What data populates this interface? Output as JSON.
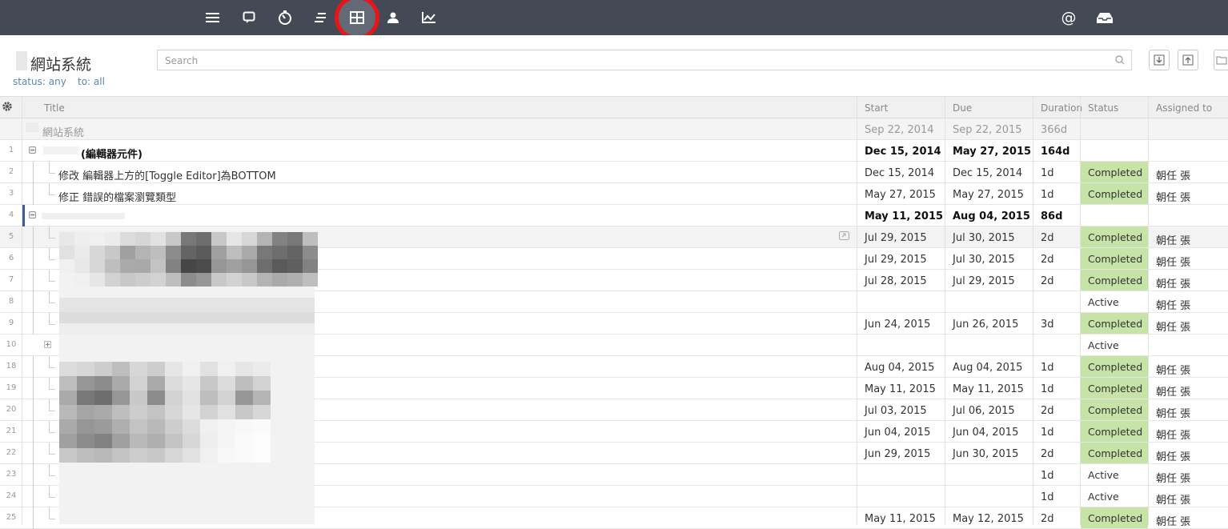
{
  "topbar": {
    "icons": [
      "menu-icon",
      "comment-icon",
      "timer-icon",
      "align-icon",
      "table-icon",
      "user-icon",
      "chart-icon"
    ],
    "right_icons": [
      "at-icon",
      "inbox-icon"
    ]
  },
  "header": {
    "project_title": "網站系統",
    "filter_status": "status: any",
    "filter_to": "to: all",
    "search_placeholder": "Search"
  },
  "columns": {
    "title": "Title",
    "start": "Start",
    "due": "Due",
    "duration": "Duration",
    "status": "Status",
    "assigned": "Assigned to"
  },
  "summary": {
    "title": "網站系統",
    "start": "Sep 22, 2014",
    "due": "Sep 22, 2015",
    "duration": "366d"
  },
  "rows": [
    {
      "num": "1",
      "title": "(編輯器元件)",
      "start": "Dec 15, 2014",
      "due": "May 27, 2015",
      "duration": "164d",
      "status": "",
      "assigned": ""
    },
    {
      "num": "2",
      "title": "修改 編輯器上方的[Toggle Editor]為BOTTOM",
      "start": "Dec 15, 2014",
      "due": "Dec 15, 2014",
      "duration": "1d",
      "status": "Completed",
      "assigned": "朝任 張"
    },
    {
      "num": "3",
      "title": "修正 錯誤的檔案瀏覽類型",
      "start": "May 27, 2015",
      "due": "May 27, 2015",
      "duration": "1d",
      "status": "Completed",
      "assigned": "朝任 張"
    },
    {
      "num": "4",
      "title": "",
      "start": "May 11, 2015",
      "due": "Aug 04, 2015",
      "duration": "86d",
      "status": "",
      "assigned": ""
    },
    {
      "num": "5",
      "title": "",
      "start": "Jul 29, 2015",
      "due": "Jul 30, 2015",
      "duration": "2d",
      "status": "Completed",
      "assigned": "朝任 張"
    },
    {
      "num": "6",
      "title": "",
      "start": "Jul 29, 2015",
      "due": "Jul 30, 2015",
      "duration": "2d",
      "status": "Completed",
      "assigned": "朝任 張"
    },
    {
      "num": "7",
      "title": "",
      "start": "Jul 28, 2015",
      "due": "Jul 29, 2015",
      "duration": "2d",
      "status": "Completed",
      "assigned": "朝任 張"
    },
    {
      "num": "8",
      "title": "",
      "start": "",
      "due": "",
      "duration": "",
      "status": "Active",
      "assigned": "朝任 張"
    },
    {
      "num": "9",
      "title": "",
      "start": "Jun 24, 2015",
      "due": "Jun 26, 2015",
      "duration": "3d",
      "status": "Completed",
      "assigned": "朝任 張"
    },
    {
      "num": "10",
      "title": "",
      "start": "",
      "due": "",
      "duration": "",
      "status": "Active",
      "assigned": ""
    },
    {
      "num": "18",
      "title": "",
      "start": "Aug 04, 2015",
      "due": "Aug 04, 2015",
      "duration": "1d",
      "status": "Completed",
      "assigned": "朝任 張"
    },
    {
      "num": "19",
      "title": "",
      "start": "May 11, 2015",
      "due": "May 11, 2015",
      "duration": "1d",
      "status": "Completed",
      "assigned": "朝任 張"
    },
    {
      "num": "20",
      "title": "",
      "start": "Jul 03, 2015",
      "due": "Jul 06, 2015",
      "duration": "2d",
      "status": "Completed",
      "assigned": "朝任 張"
    },
    {
      "num": "21",
      "title": "",
      "start": "Jun 04, 2015",
      "due": "Jun 04, 2015",
      "duration": "1d",
      "status": "Completed",
      "assigned": "朝任 張"
    },
    {
      "num": "22",
      "title": "",
      "start": "Jun 29, 2015",
      "due": "Jun 30, 2015",
      "duration": "2d",
      "status": "Completed",
      "assigned": "朝任 張"
    },
    {
      "num": "23",
      "title": "",
      "start": "",
      "due": "",
      "duration": "1d",
      "status": "Active",
      "assigned": "朝任 張"
    },
    {
      "num": "24",
      "title": "",
      "start": "",
      "due": "",
      "duration": "1d",
      "status": "Active",
      "assigned": "朝任 張"
    },
    {
      "num": "25",
      "title": "",
      "start": "May 11, 2015",
      "due": "May 12, 2015",
      "duration": "2d",
      "status": "Completed",
      "assigned": "朝任 張"
    }
  ]
}
